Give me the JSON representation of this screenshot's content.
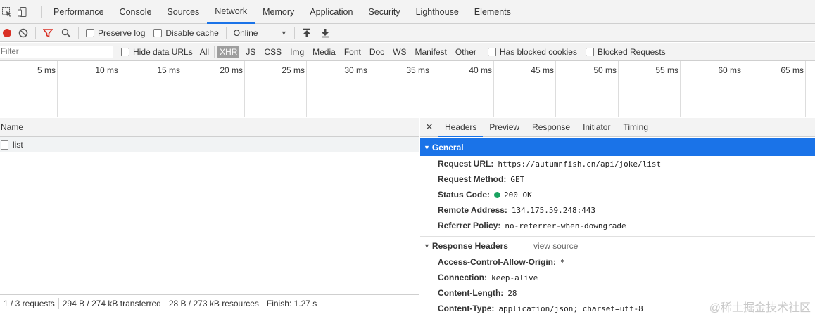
{
  "tabs": [
    "Performance",
    "Console",
    "Sources",
    "Network",
    "Memory",
    "Application",
    "Security",
    "Lighthouse",
    "Elements"
  ],
  "toolbar": {
    "preserve_log": "Preserve log",
    "disable_cache": "Disable cache",
    "throttle": "Online"
  },
  "filter": {
    "placeholder": "Filter",
    "hide_data_urls": "Hide data URLs",
    "types": [
      "All",
      "XHR",
      "JS",
      "CSS",
      "Img",
      "Media",
      "Font",
      "Doc",
      "WS",
      "Manifest",
      "Other"
    ],
    "blocked_cookies": "Has blocked cookies",
    "blocked_requests": "Blocked Requests"
  },
  "timeline": [
    "5 ms",
    "10 ms",
    "15 ms",
    "20 ms",
    "25 ms",
    "30 ms",
    "35 ms",
    "40 ms",
    "45 ms",
    "50 ms",
    "55 ms",
    "60 ms",
    "65 ms"
  ],
  "list": {
    "header": "Name",
    "rows": [
      "list"
    ]
  },
  "status": {
    "requests": "1 / 3 requests",
    "transferred": "294 B / 274 kB transferred",
    "resources": "28 B / 273 kB resources",
    "finish": "Finish: 1.27 s"
  },
  "detail": {
    "tabs": [
      "Headers",
      "Preview",
      "Response",
      "Initiator",
      "Timing"
    ],
    "general_title": "General",
    "general": [
      {
        "k": "Request URL:",
        "v": "https://autumnfish.cn/api/joke/list"
      },
      {
        "k": "Request Method:",
        "v": "GET"
      },
      {
        "k": "Status Code:",
        "v": "200 OK"
      },
      {
        "k": "Remote Address:",
        "v": "134.175.59.248:443"
      },
      {
        "k": "Referrer Policy:",
        "v": "no-referrer-when-downgrade"
      }
    ],
    "response_title": "Response Headers",
    "view_source": "view source",
    "response": [
      {
        "k": "Access-Control-Allow-Origin:",
        "v": "*"
      },
      {
        "k": "Connection:",
        "v": "keep-alive"
      },
      {
        "k": "Content-Length:",
        "v": "28"
      },
      {
        "k": "Content-Type:",
        "v": "application/json; charset=utf-8"
      }
    ]
  },
  "watermark": "@稀土掘金技术社区",
  "colors": {
    "accent": "#1a73e8",
    "record": "#d93025",
    "status_ok": "#1aa260"
  }
}
